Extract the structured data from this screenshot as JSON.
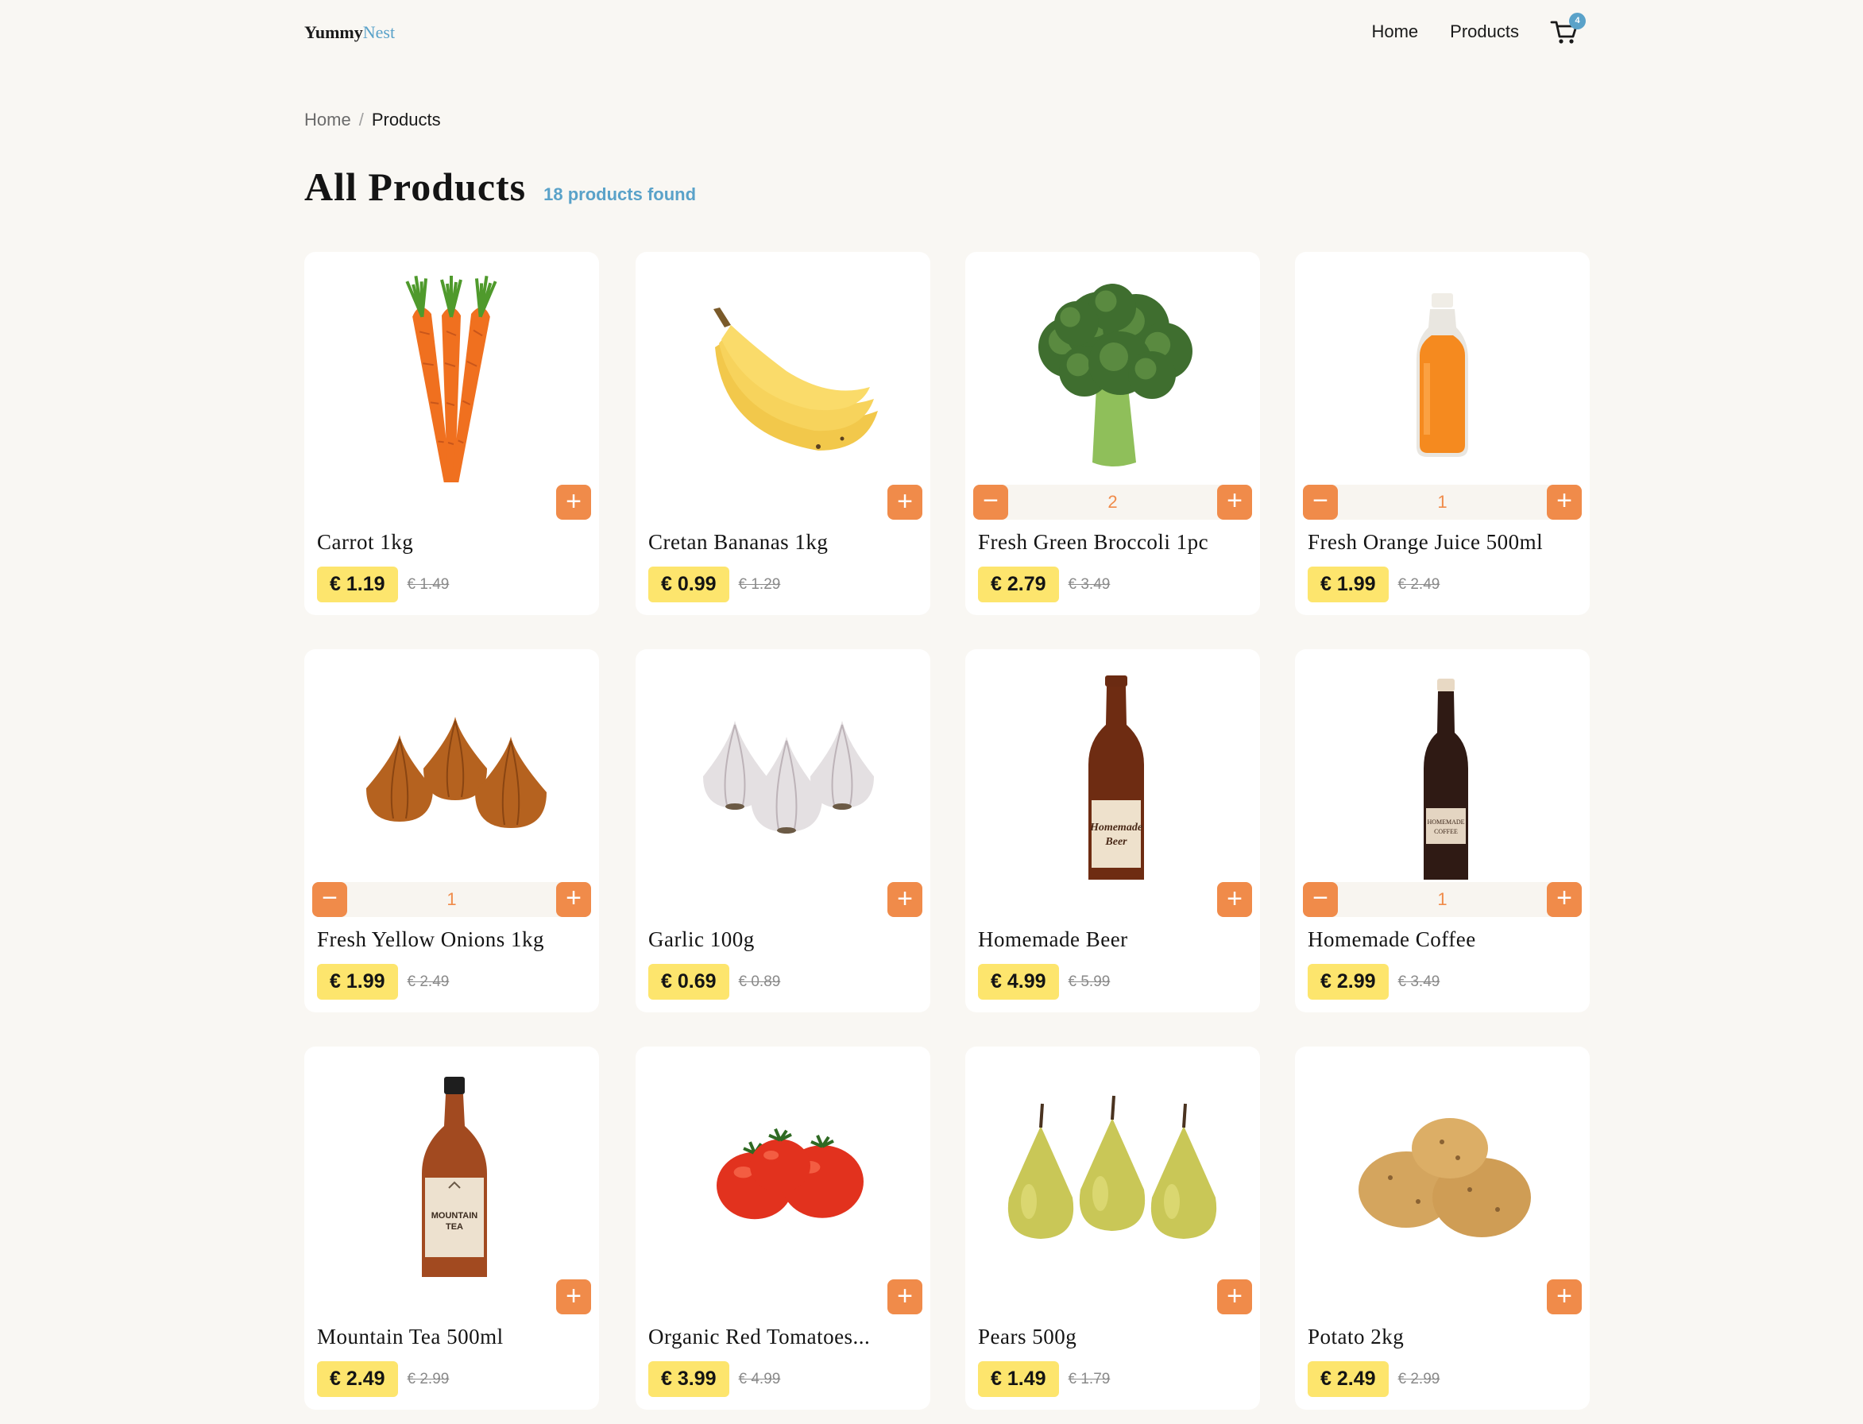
{
  "brand": {
    "part1": "Yummy",
    "part2": "Nest"
  },
  "nav": {
    "home": "Home",
    "products": "Products",
    "cart_count": "4"
  },
  "breadcrumb": {
    "home": "Home",
    "sep": "/",
    "current": "Products"
  },
  "page": {
    "title": "All Products",
    "count": "18 products found"
  },
  "products": [
    {
      "name": "Carrot 1kg",
      "price": "€ 1.19",
      "old": "€ 1.49",
      "qty": null,
      "icon": "carrot-image"
    },
    {
      "name": "Cretan Bananas 1kg",
      "price": "€ 0.99",
      "old": "€ 1.29",
      "qty": null,
      "icon": "banana-image"
    },
    {
      "name": "Fresh Green Broccoli 1pc",
      "price": "€ 2.79",
      "old": "€ 3.49",
      "qty": "2",
      "icon": "broccoli-image"
    },
    {
      "name": "Fresh Orange Juice 500ml",
      "price": "€ 1.99",
      "old": "€ 2.49",
      "qty": "1",
      "icon": "orange-juice-image"
    },
    {
      "name": "Fresh Yellow Onions 1kg",
      "price": "€ 1.99",
      "old": "€ 2.49",
      "qty": "1",
      "icon": "onion-image"
    },
    {
      "name": "Garlic 100g",
      "price": "€ 0.69",
      "old": "€ 0.89",
      "qty": null,
      "icon": "garlic-image"
    },
    {
      "name": "Homemade Beer",
      "price": "€ 4.99",
      "old": "€ 5.99",
      "qty": null,
      "icon": "beer-bottle-image",
      "label": "Homemade Beer"
    },
    {
      "name": "Homemade Coffee",
      "price": "€ 2.99",
      "old": "€ 3.49",
      "qty": "1",
      "icon": "coffee-bottle-image",
      "label": "HOMEMADE COFFEE"
    },
    {
      "name": "Mountain Tea 500ml",
      "price": "€ 2.49",
      "old": "€ 2.99",
      "qty": null,
      "icon": "tea-bottle-image",
      "label": "MOUNTAIN TEA"
    },
    {
      "name": "Organic Red Tomatoes...",
      "price": "€ 3.99",
      "old": "€ 4.99",
      "qty": null,
      "icon": "tomato-image"
    },
    {
      "name": "Pears 500g",
      "price": "€ 1.49",
      "old": "€ 1.79",
      "qty": null,
      "icon": "pear-image"
    },
    {
      "name": "Potato 2kg",
      "price": "€ 2.49",
      "old": "€ 2.99",
      "qty": null,
      "icon": "potato-image"
    }
  ],
  "colors": {
    "accent": "#f08b4a",
    "price_bg": "#fde56d",
    "link": "#5aa2c9",
    "background": "#f9f7f3"
  }
}
